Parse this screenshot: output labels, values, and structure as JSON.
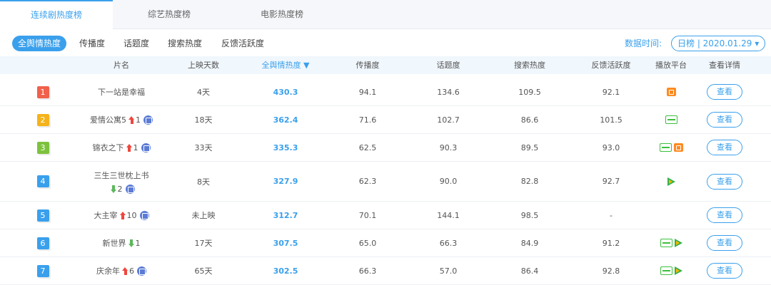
{
  "tabs": [
    {
      "label": "连续剧热度榜",
      "active": true
    },
    {
      "label": "综艺热度榜",
      "active": false
    },
    {
      "label": "电影热度榜",
      "active": false
    }
  ],
  "sub_nav": {
    "items": [
      {
        "label": "全舆情热度",
        "active": true
      },
      {
        "label": "传播度",
        "active": false
      },
      {
        "label": "话题度",
        "active": false
      },
      {
        "label": "搜索热度",
        "active": false
      },
      {
        "label": "反馈活跃度",
        "active": false
      }
    ],
    "date_label": "数据时间:",
    "date_value": "日榜 | 2020.01.29 ▾"
  },
  "table": {
    "columns": [
      "片名",
      "上映天数",
      "全舆情热度 ▼",
      "传播度",
      "话题度",
      "搜索热度",
      "反馈活跃度",
      "播放平台",
      "查看详情"
    ],
    "view_label": "查看",
    "rows": [
      {
        "rank": "1",
        "rank_color": "#f0604a",
        "title": "下一站是幸福",
        "change": "",
        "change_dir": "",
        "is_new": false,
        "days": "4天",
        "score": "430.3",
        "spread": "94.1",
        "topic": "134.6",
        "search": "109.5",
        "feedback": "92.1",
        "platforms": [
          "mgtv"
        ]
      },
      {
        "rank": "2",
        "rank_color": "#f5b31b",
        "title": "爱情公寓5",
        "change": "1",
        "change_dir": "up",
        "is_new": true,
        "days": "18天",
        "score": "362.4",
        "spread": "71.6",
        "topic": "102.7",
        "search": "86.6",
        "feedback": "101.5",
        "platforms": [
          "iqiyi"
        ]
      },
      {
        "rank": "3",
        "rank_color": "#7dc23d",
        "title": "锦衣之下",
        "change": "1",
        "change_dir": "up",
        "is_new": true,
        "days": "33天",
        "score": "335.3",
        "spread": "62.5",
        "topic": "90.3",
        "search": "89.5",
        "feedback": "93.0",
        "platforms": [
          "iqiyi",
          "mgtv"
        ]
      },
      {
        "rank": "4",
        "rank_color": "#3aa0ec",
        "title": "三生三世枕上书",
        "change": "2",
        "change_dir": "down",
        "is_new": true,
        "days": "8天",
        "score": "327.9",
        "spread": "62.3",
        "topic": "90.0",
        "search": "82.8",
        "feedback": "92.7",
        "platforms": [
          "tencent"
        ]
      },
      {
        "rank": "5",
        "rank_color": "#3aa0ec",
        "title": "大主宰",
        "change": "10",
        "change_dir": "up",
        "is_new": true,
        "days": "未上映",
        "score": "312.7",
        "spread": "70.1",
        "topic": "144.1",
        "search": "98.5",
        "feedback": "-",
        "platforms": []
      },
      {
        "rank": "6",
        "rank_color": "#3aa0ec",
        "title": "新世界",
        "change": "1",
        "change_dir": "down",
        "is_new": false,
        "days": "17天",
        "score": "307.5",
        "spread": "65.0",
        "topic": "66.3",
        "search": "84.9",
        "feedback": "91.2",
        "platforms": [
          "iqiyi",
          "tencent"
        ]
      },
      {
        "rank": "7",
        "rank_color": "#3aa0ec",
        "title": "庆余年",
        "change": "6",
        "change_dir": "up",
        "is_new": true,
        "days": "65天",
        "score": "302.5",
        "spread": "66.3",
        "topic": "57.0",
        "search": "86.4",
        "feedback": "92.8",
        "platforms": [
          "iqiyi",
          "tencent"
        ]
      }
    ]
  },
  "colors": {
    "accent": "#3aa0ec",
    "up": "#f0463c",
    "down": "#5cb85c"
  }
}
